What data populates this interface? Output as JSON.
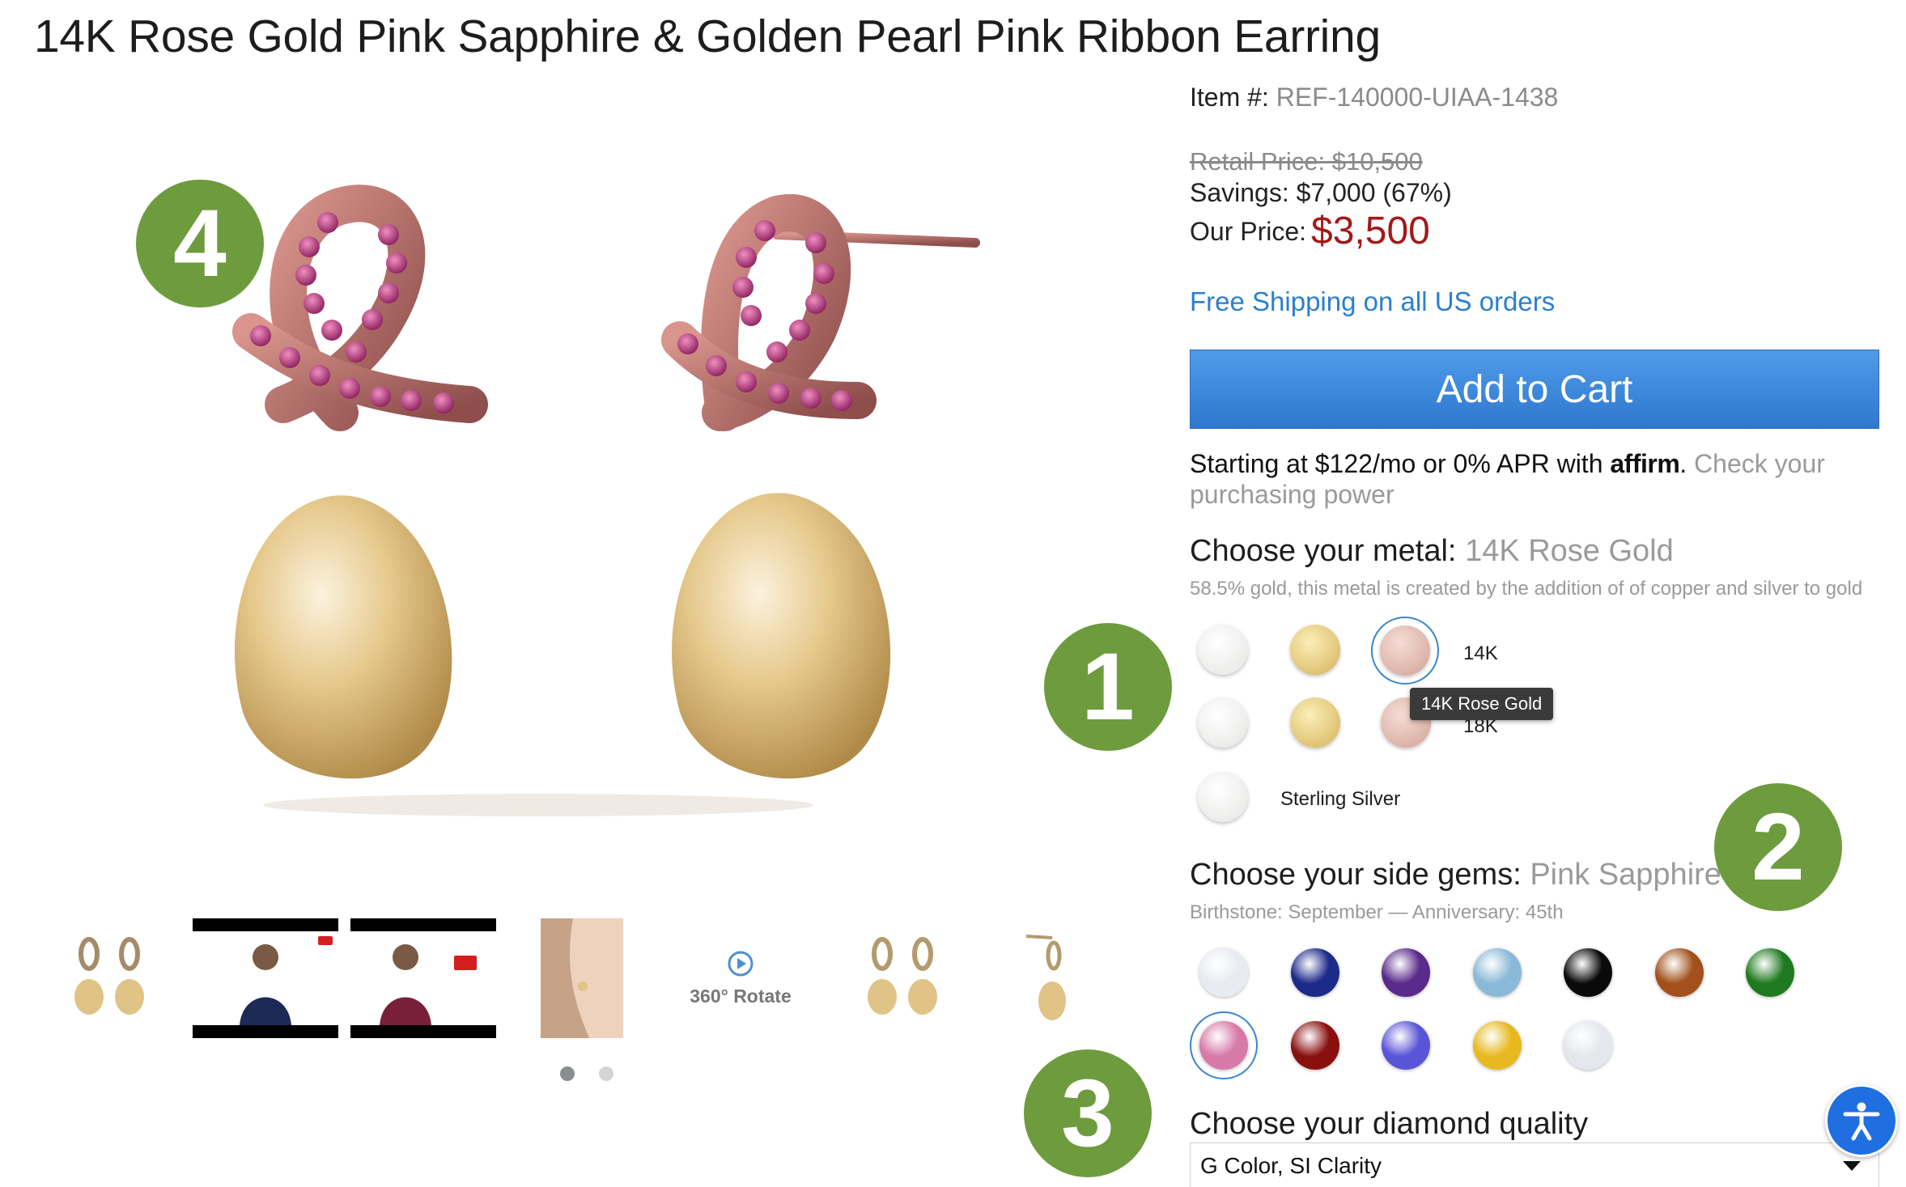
{
  "product": {
    "title": "14K Rose Gold Pink Sapphire & Golden Pearl Pink Ribbon Earring",
    "item_label": "Item #:",
    "item_number": "REF-140000-UIAA-1438",
    "retail_price": "Retail Price: $10,500",
    "savings": "Savings: $7,000 (67%)",
    "our_price_label": "Our Price:",
    "our_price": "$3,500",
    "free_shipping": "Free Shipping on all US orders",
    "add_to_cart": "Add to Cart"
  },
  "affirm": {
    "text": "Starting at $122/mo or 0% APR with",
    "brand": "affirm",
    "link": "Check your purchasing power"
  },
  "metal": {
    "label": "Choose your metal:",
    "selected": "14K Rose Gold",
    "description": "58.5% gold, this metal is created by the addition of of copper and silver to gold",
    "row_14k": "14K",
    "row_18k": "18K",
    "row_silver": "Sterling Silver",
    "tooltip": "14K Rose Gold",
    "colors": {
      "white": "#f1f1f0",
      "yellow": "#e0c46a",
      "rose": "#e3bcb1"
    }
  },
  "side_gems": {
    "label": "Choose your side gems:",
    "selected": "Pink Sapphire",
    "subtitle": "Birthstone: September — Anniversary: 45th",
    "gems": [
      {
        "name": "diamond",
        "color": "#e8ecf2"
      },
      {
        "name": "blue-sapphire",
        "color": "#1c2a8a"
      },
      {
        "name": "amethyst",
        "color": "#5a2a8c"
      },
      {
        "name": "aquamarine",
        "color": "#8ab8d8"
      },
      {
        "name": "black-diamond",
        "color": "#0a0a0a"
      },
      {
        "name": "citrine-brown",
        "color": "#a2501c"
      },
      {
        "name": "emerald",
        "color": "#1f7a1f"
      },
      {
        "name": "pink-sapphire",
        "color": "#d77aa8"
      },
      {
        "name": "ruby",
        "color": "#8a1010"
      },
      {
        "name": "tanzanite",
        "color": "#5a55d8"
      },
      {
        "name": "yellow-sapphire",
        "color": "#e8b820"
      },
      {
        "name": "white-sapphire",
        "color": "#e4e8ee"
      }
    ]
  },
  "diamond_quality": {
    "label": "Choose your diamond quality",
    "value": "G Color, SI Clarity"
  },
  "thumbnails": {
    "rotate_label": "360° Rotate",
    "tv_badge": "TV"
  },
  "badges": [
    "4",
    "1",
    "2",
    "3"
  ],
  "colors": {
    "badge_green": "#6d9b3d",
    "price_red": "#a31919",
    "link_blue": "#2a7fcf",
    "cart_blue": "#3d8ade",
    "accessibility_blue": "#1f6fe0"
  }
}
